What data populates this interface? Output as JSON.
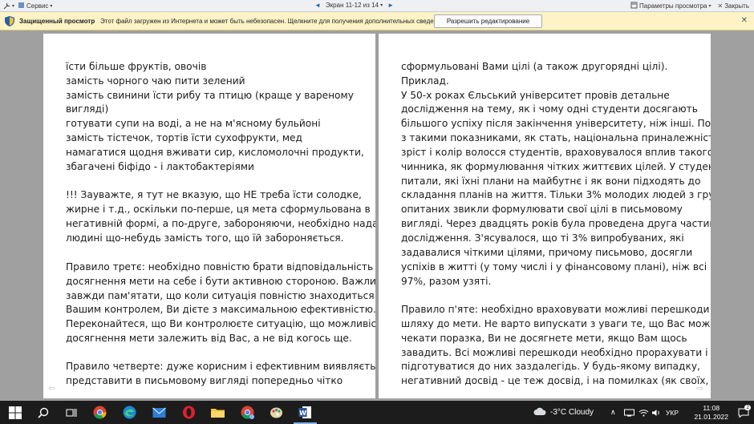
{
  "toolbar": {
    "service_label": "Сервис",
    "screen_indicator": "Экран 11-12 из 14",
    "view_params_label": "Параметры просмотра",
    "close_label": "Закрыть"
  },
  "protected_view": {
    "title": "Защищенный просмотр",
    "message": "Этот файл загружен из Интернета и может быть небезопасен. Щелкните для получения дополнительных сведений.",
    "button_label": "Разрешить редактирование"
  },
  "left_page": {
    "lines": [
      "їсти більше фруктів, овочів",
      "замість чорного чаю пити зелений",
      "замість свинини їсти рибу та птицю (краще у вареному",
      "вигляді)",
      "готувати супи на воді, а не на м'ясному бульйоні",
      "замість тістечок, тортів їсти сухофрукти, мед",
      "намагатися щодня вживати сир, кисломолочні продукти,",
      "збагачені біфідо - і лактобактеріями",
      "!!! Зауважте, я тут не вказую, що НЕ треба їсти солодке,",
      "жирне і т.д., оскільки по-перше, ця мета сформульована в",
      "негативній формі, а по-друге, забороняючи, необхідно надати",
      "людині що-небудь замість того, що їй забороняється.",
      "Правило третє: необхідно повністю брати відповідальність за",
      "досягнення мети на себе і бути активною стороною. Важливо",
      "завжди пам'ятати, що коли ситуація повністю знаходиться під",
      "Вашим контролем, Ви дієте з максимальною ефективністю.",
      "Переконайтеся, що Ви контролюєте ситуацію, що можливість",
      "досягнення мети залежить від Вас, а не від когось ще.",
      "Правило четверте: дуже корисним і ефективним виявляється",
      "представити в письмовому вигляді попередньо чітко"
    ]
  },
  "right_page": {
    "lines": [
      "сформульовані Вами цілі (а також другорядні цілі).",
      "Приклад.",
      "У 50-х роках Єльський університет провів детальне",
      "дослідження на тему, як і чому одні студенти досягають",
      "більшого успіху після закінчення університету, ніж інші. Поряд",
      "з такими показниками, як стать, національна приналежність,",
      "зріст і колір волосся студентів, враховувалося вплив такого",
      "чинника, як формулювання чітких життєвих цілей. У студентів",
      "питали, які їхні плани на майбутнє і як вони підходять до",
      "складання планів на життя. Тільки 3% молодих людей з групи",
      "опитаних звикли формулювати свої цілі в письмовому",
      "вигляді. Через двадцять років була проведена друга частина",
      "дослідження. З'ясувалося, що ті 3% випробуваних, які",
      "задавалися чіткими цілями, причому письмово, досягли",
      "успіхів в житті (у тому числі і у фінансовому плані), ніж всі інші",
      "97%, разом узяті.",
      "Правило п'яте: необхідно враховувати можливі перешкоди на",
      "шляху до мети. Не варто випускати з уваги те, що Вас може",
      "чекати поразка, Ви не досягнете мети, якщо Вам щось",
      "завадить. Всі можливі перешкоди необхідно прорахувати і",
      "підготуватися до них заздалегідь. У будь-якому випадку,",
      "негативний досвід - це теж досвід, і на помилках (як своїх, так"
    ]
  },
  "taskbar": {
    "weather": "-3°C  Cloudy",
    "language": "УКР",
    "time": "11:08",
    "date": "21.01.2022",
    "notification_count": "2"
  },
  "colors": {
    "protected_bar": "#fdf3c7",
    "taskbar": "#1c1c1c",
    "page_background": "#a0a0a0"
  }
}
